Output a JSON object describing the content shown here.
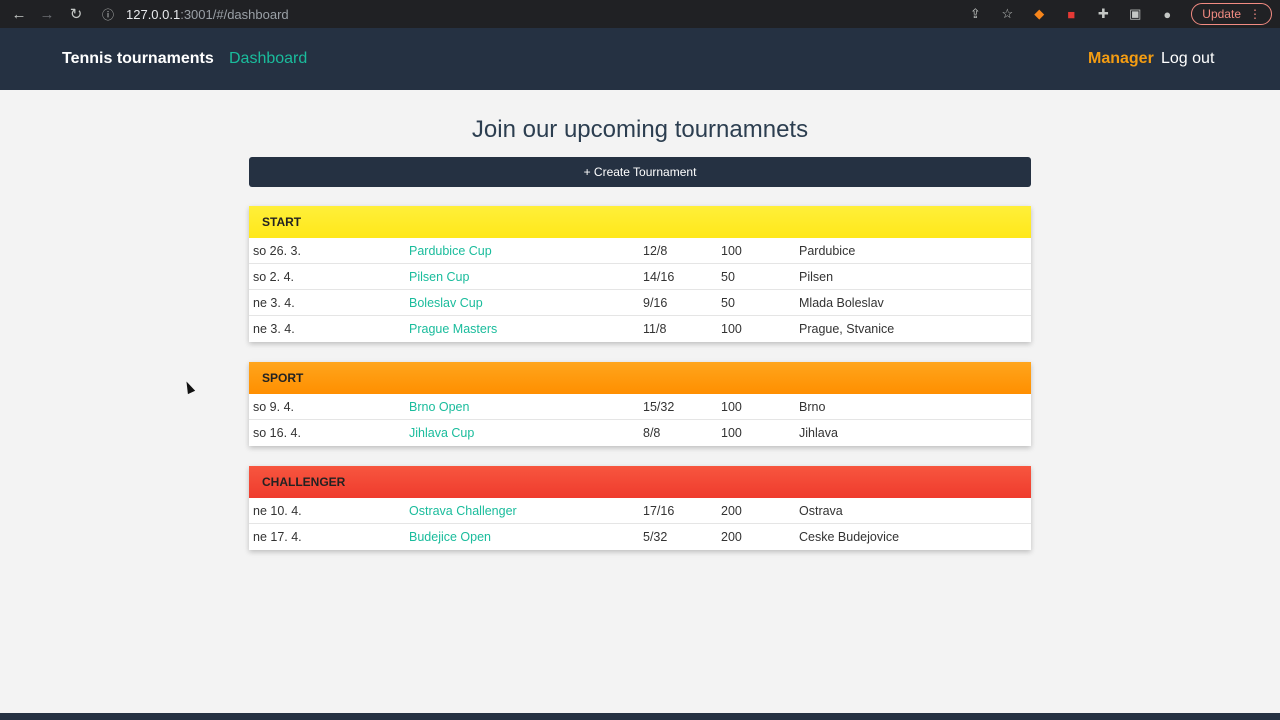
{
  "browser": {
    "url_host": "127.0.0.1",
    "url_path": ":3001/#/dashboard",
    "update_label": "Update"
  },
  "header": {
    "brand": "Tennis tournaments",
    "dashboard_link": "Dashboard",
    "manager_link": "Manager",
    "logout_link": "Log out"
  },
  "main": {
    "title": "Join our upcoming tournamnets",
    "create_button": "+ Create Tournament"
  },
  "colors": {
    "header_bg": "#253142",
    "accent_link": "#1abc9c",
    "manager": "#f39c12",
    "start": "#ffea1f",
    "sport": "#ff9a0f",
    "challenger": "#f44336"
  },
  "categories": [
    {
      "name": "START",
      "rows": [
        {
          "date": "so 26. 3.",
          "name": "Pardubice Cup",
          "players": "12/8",
          "points": "100",
          "city": "Pardubice"
        },
        {
          "date": "so 2. 4.",
          "name": "Pilsen Cup",
          "players": "14/16",
          "points": "50",
          "city": "Pilsen"
        },
        {
          "date": "ne 3. 4.",
          "name": "Boleslav Cup",
          "players": "9/16",
          "points": "50",
          "city": "Mlada Boleslav"
        },
        {
          "date": "ne 3. 4.",
          "name": "Prague Masters",
          "players": "11/8",
          "points": "100",
          "city": "Prague, Stvanice"
        }
      ]
    },
    {
      "name": "SPORT",
      "rows": [
        {
          "date": "so 9. 4.",
          "name": "Brno Open",
          "players": "15/32",
          "points": "100",
          "city": "Brno"
        },
        {
          "date": "so 16. 4.",
          "name": "Jihlava Cup",
          "players": "8/8",
          "points": "100",
          "city": "Jihlava"
        }
      ]
    },
    {
      "name": "CHALLENGER",
      "rows": [
        {
          "date": "ne 10. 4.",
          "name": "Ostrava Challenger",
          "players": "17/16",
          "points": "200",
          "city": "Ostrava"
        },
        {
          "date": "ne 17. 4.",
          "name": "Budejice Open",
          "players": "5/32",
          "points": "200",
          "city": "Ceske Budejovice"
        }
      ]
    }
  ]
}
